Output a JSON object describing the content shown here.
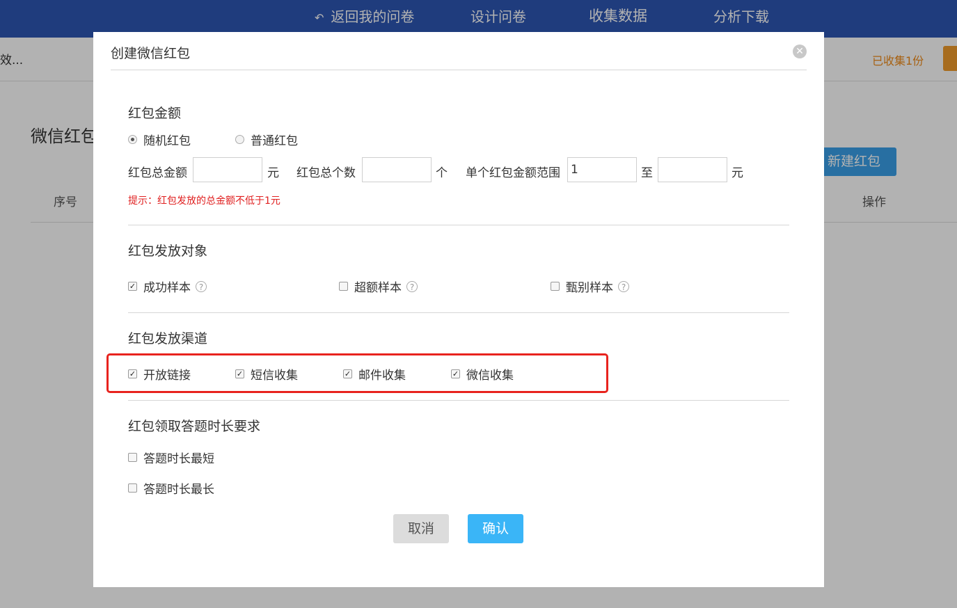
{
  "topnav": {
    "back": "返回我的问卷",
    "design": "设计问卷",
    "collect": "收集数据",
    "analyze": "分析下载"
  },
  "subbar": {
    "survey_name": "效...",
    "collected": "已收集1份"
  },
  "page": {
    "title": "微信红包",
    "new_button": "新建红包",
    "col_index": "序号",
    "col_action": "操作"
  },
  "modal": {
    "title": "创建微信红包",
    "amount": {
      "title": "红包金额",
      "random": "随机红包",
      "normal": "普通红包",
      "total_amount_label": "红包总金额",
      "total_amount_value": "",
      "yuan1": "元",
      "total_count_label": "红包总个数",
      "total_count_value": "",
      "ge": "个",
      "range_label": "单个红包金额范围",
      "range_min": "1",
      "to": "至",
      "range_max": "",
      "yuan2": "元",
      "hint": "提示：红包发放的总金额不低于1元"
    },
    "target": {
      "title": "红包发放对象",
      "success": "成功样本",
      "over": "超额样本",
      "screen": "甄别样本"
    },
    "channel": {
      "title": "红包发放渠道",
      "open_link": "开放链接",
      "sms": "短信收集",
      "email": "邮件收集",
      "wechat": "微信收集"
    },
    "duration": {
      "title": "红包领取答题时长要求",
      "shortest": "答题时长最短",
      "longest": "答题时长最长"
    },
    "cancel": "取消",
    "confirm": "确认"
  },
  "colors": {
    "nav_blue": "#2d56b3",
    "confirm_blue": "#3ab5f7",
    "hint_red": "#e02020",
    "highlight_red": "#e8231e",
    "collected_orange": "#ef8c1a"
  }
}
